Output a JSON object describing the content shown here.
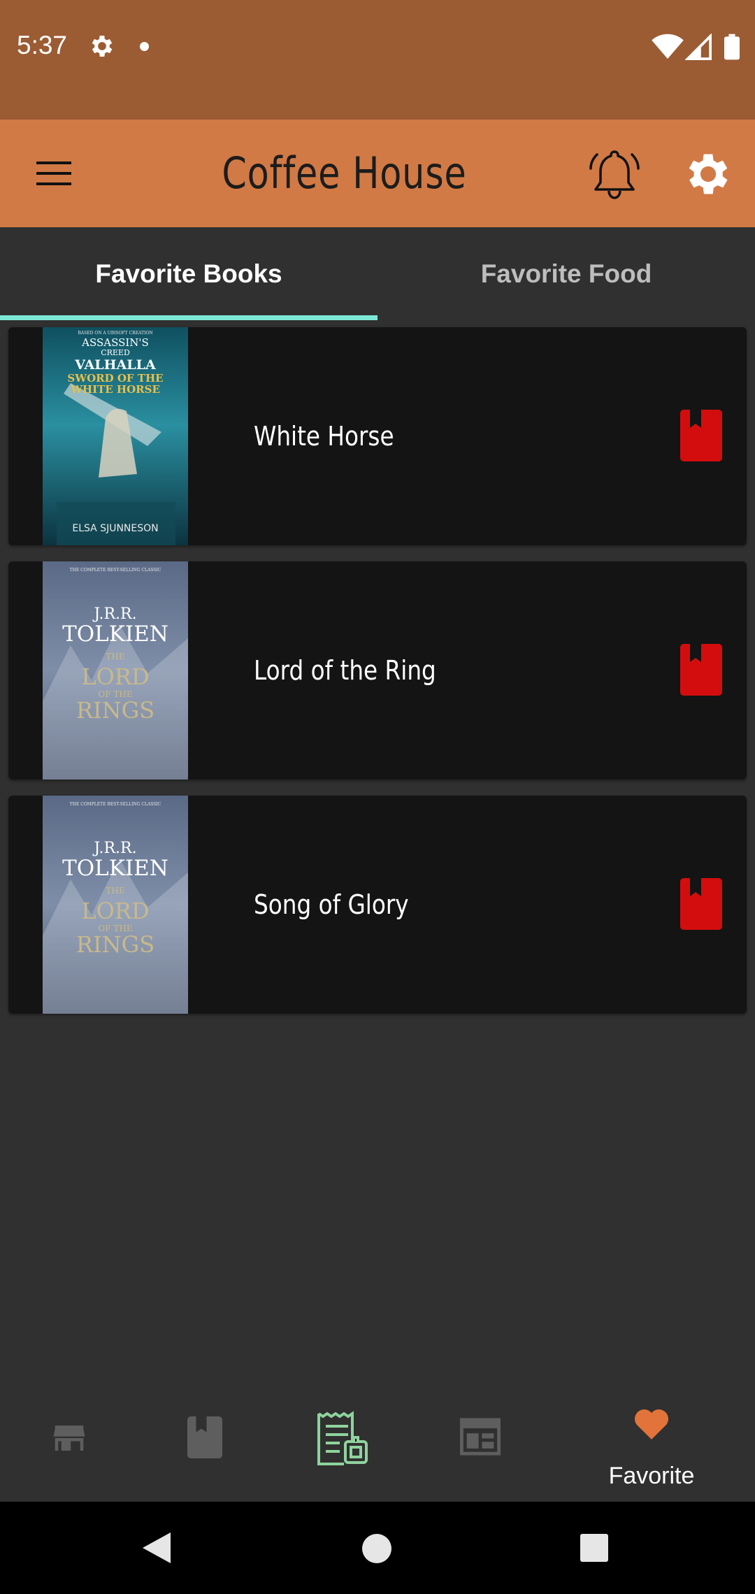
{
  "status_bar": {
    "time": "5:37",
    "icons": [
      "settings-icon",
      "notification-dot-icon",
      "wifi-icon",
      "cell-signal-icon",
      "battery-icon"
    ]
  },
  "app_bar": {
    "title": "Coffee House",
    "background": "#d17a45",
    "icons": [
      "menu-icon",
      "bell-icon",
      "settings-icon"
    ]
  },
  "tabs": [
    {
      "label": "Favorite Books",
      "active": true
    },
    {
      "label": "Favorite Food",
      "active": false
    }
  ],
  "accent": {
    "tab_indicator": "#7ee8d6",
    "bookmark": "#d30d0d",
    "favorite_active": "#e2733a"
  },
  "books": [
    {
      "title": "White Horse",
      "cover": {
        "series_top": "BASED ON A UBISOFT CREATION",
        "line1": "ASSASSIN'S",
        "line2": "CREED",
        "line3": "VALHALLA",
        "line4": "SWORD OF THE",
        "line5": "WHITE HORSE",
        "author": "ELSA SJUNNESON"
      }
    },
    {
      "title": "Lord of the Ring",
      "cover": {
        "series_top": "THE COMPLETE BEST-SELLING CLASSIC",
        "author_line1": "J.R.R.",
        "author_line2": "TOLKIEN",
        "title_line1": "THE",
        "title_line2": "LORD",
        "title_line3": "OF THE",
        "title_line4": "RINGS"
      }
    },
    {
      "title": "Song of Glory",
      "cover": {
        "series_top": "THE COMPLETE BEST-SELLING CLASSIC",
        "author_line1": "J.R.R.",
        "author_line2": "TOLKIEN",
        "title_line1": "THE",
        "title_line2": "LORD",
        "title_line3": "OF THE",
        "title_line4": "RINGS"
      }
    }
  ],
  "bottom_nav": {
    "items": [
      {
        "icon": "store-icon",
        "label": ""
      },
      {
        "icon": "book-icon",
        "label": ""
      },
      {
        "icon": "receipt-icon",
        "label": ""
      },
      {
        "icon": "news-icon",
        "label": ""
      },
      {
        "icon": "heart-icon",
        "label": "Favorite",
        "active": true
      }
    ]
  },
  "system_nav": [
    "back-icon",
    "home-icon",
    "recents-icon"
  ]
}
